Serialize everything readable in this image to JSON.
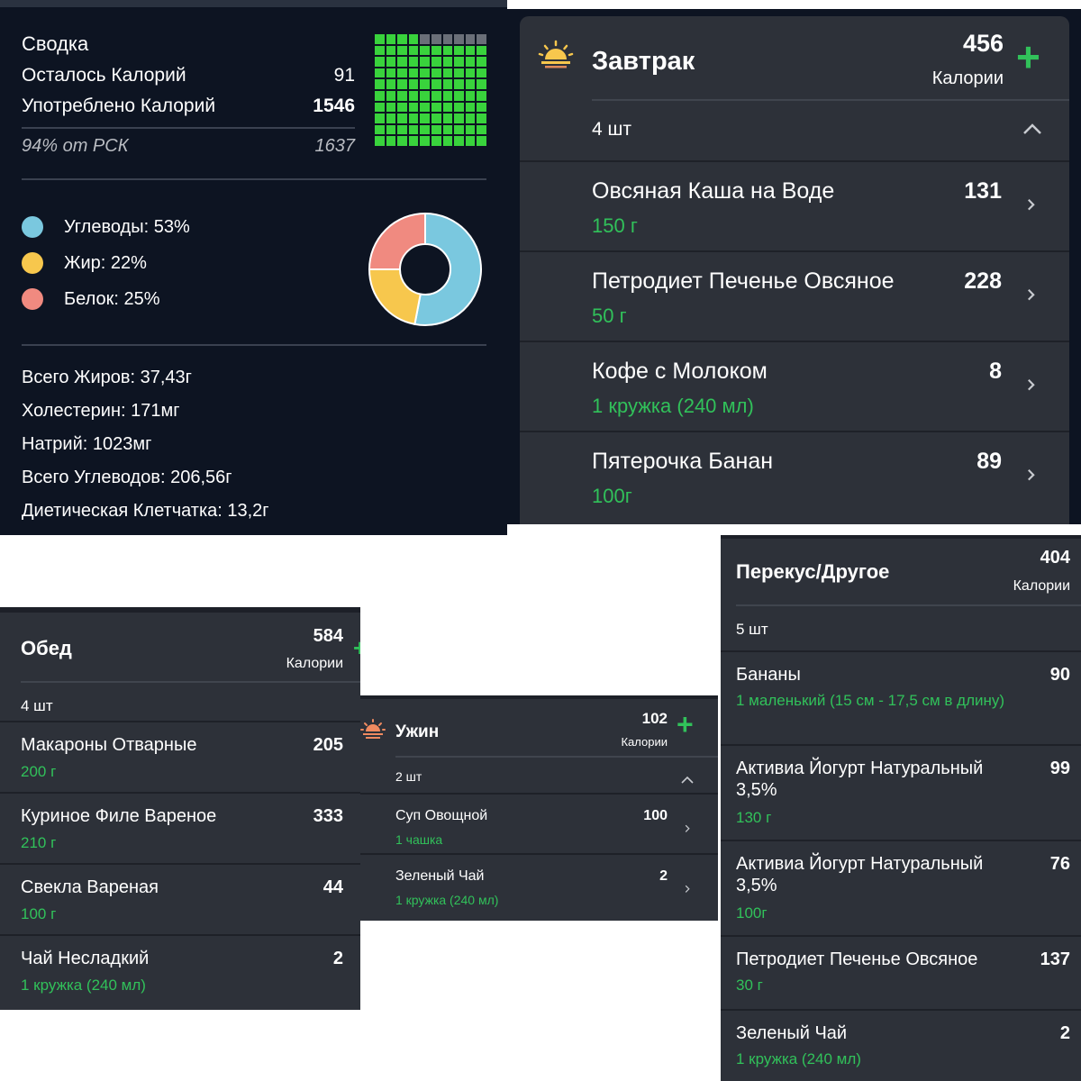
{
  "summary": {
    "title": "Сводка",
    "remaining_label": "Осталось Калорий",
    "remaining_value": "91",
    "consumed_label": "Употреблено Калорий",
    "consumed_value": "1546",
    "percent_label": "94% от РСК",
    "percent_value": "1637",
    "macros": [
      {
        "label": "Углеводы: 53%",
        "color": "#7ac8df",
        "percent": 53
      },
      {
        "label": "Жир: 22%",
        "color": "#f7c74d",
        "percent": 22
      },
      {
        "label": "Белок: 25%",
        "color": "#f08a80",
        "percent": 25
      }
    ],
    "nutrients": [
      "Всего Жиров: 37,43г",
      "Холестерин: 171мг",
      "Натрий: 1023мг",
      "Всего Углеводов: 206,56г",
      "Диетическая Клетчатка: 13,2г"
    ],
    "progress_fraction": 0.94,
    "grid_filled_color": "#39d33c",
    "grid_empty_color": "#6a6f78"
  },
  "breakfast": {
    "title": "Завтрак",
    "calories": "456",
    "calories_label": "Калории",
    "count": "4 шт",
    "icon": "sunrise-icon",
    "items": [
      {
        "name": "Овсяная Каша на Воде",
        "amount": "150 г",
        "cal": "131"
      },
      {
        "name": "Петродиет Печенье Овсяное",
        "amount": "50 г",
        "cal": "228"
      },
      {
        "name": "Кофе с Молоком",
        "amount": "1 кружка (240 мл)",
        "cal": "8"
      },
      {
        "name": "Пятерочка Банан",
        "amount": "100г",
        "cal": "89"
      }
    ]
  },
  "lunch": {
    "title": "Обед",
    "calories": "584",
    "calories_label": "Калории",
    "count": "4 шт",
    "icon": "sun-icon",
    "items": [
      {
        "name": "Макароны Отварные",
        "amount": "200 г",
        "cal": "205"
      },
      {
        "name": "Куриное Филе Вареное",
        "amount": "210 г",
        "cal": "333"
      },
      {
        "name": "Свекла Вареная",
        "amount": "100 г",
        "cal": "44"
      },
      {
        "name": "Чай Несладкий",
        "amount": "1 кружка (240 мл)",
        "cal": "2"
      }
    ]
  },
  "dinner": {
    "title": "Ужин",
    "calories": "102",
    "calories_label": "Калории",
    "count": "2 шт",
    "icon": "sunset-icon",
    "items": [
      {
        "name": "Суп Овощной",
        "amount": "1 чашка",
        "cal": "100"
      },
      {
        "name": "Зеленый Чай",
        "amount": "1 кружка (240 мл)",
        "cal": "2"
      }
    ]
  },
  "snack": {
    "title": "Перекус/Другое",
    "calories": "404",
    "calories_label": "Калории",
    "count": "5 шт",
    "items": [
      {
        "name": "Бананы",
        "amount": "1 маленький (15 см - 17,5 см в длину)",
        "cal": "90"
      },
      {
        "name": "Активиа Йогурт Натуральный 3,5%",
        "amount": "130 г",
        "cal": "99"
      },
      {
        "name": "Активиа Йогурт Натуральный 3,5%",
        "amount": "100г",
        "cal": "76"
      },
      {
        "name": "Петродиет Печенье Овсяное",
        "amount": "30 г",
        "cal": "137"
      },
      {
        "name": "Зеленый Чай",
        "amount": "1 кружка (240 мл)",
        "cal": "2"
      }
    ]
  },
  "colors": {
    "accent_green": "#31c15a",
    "panel_bg": "#2d3139",
    "summary_bg": "#0d1422"
  }
}
